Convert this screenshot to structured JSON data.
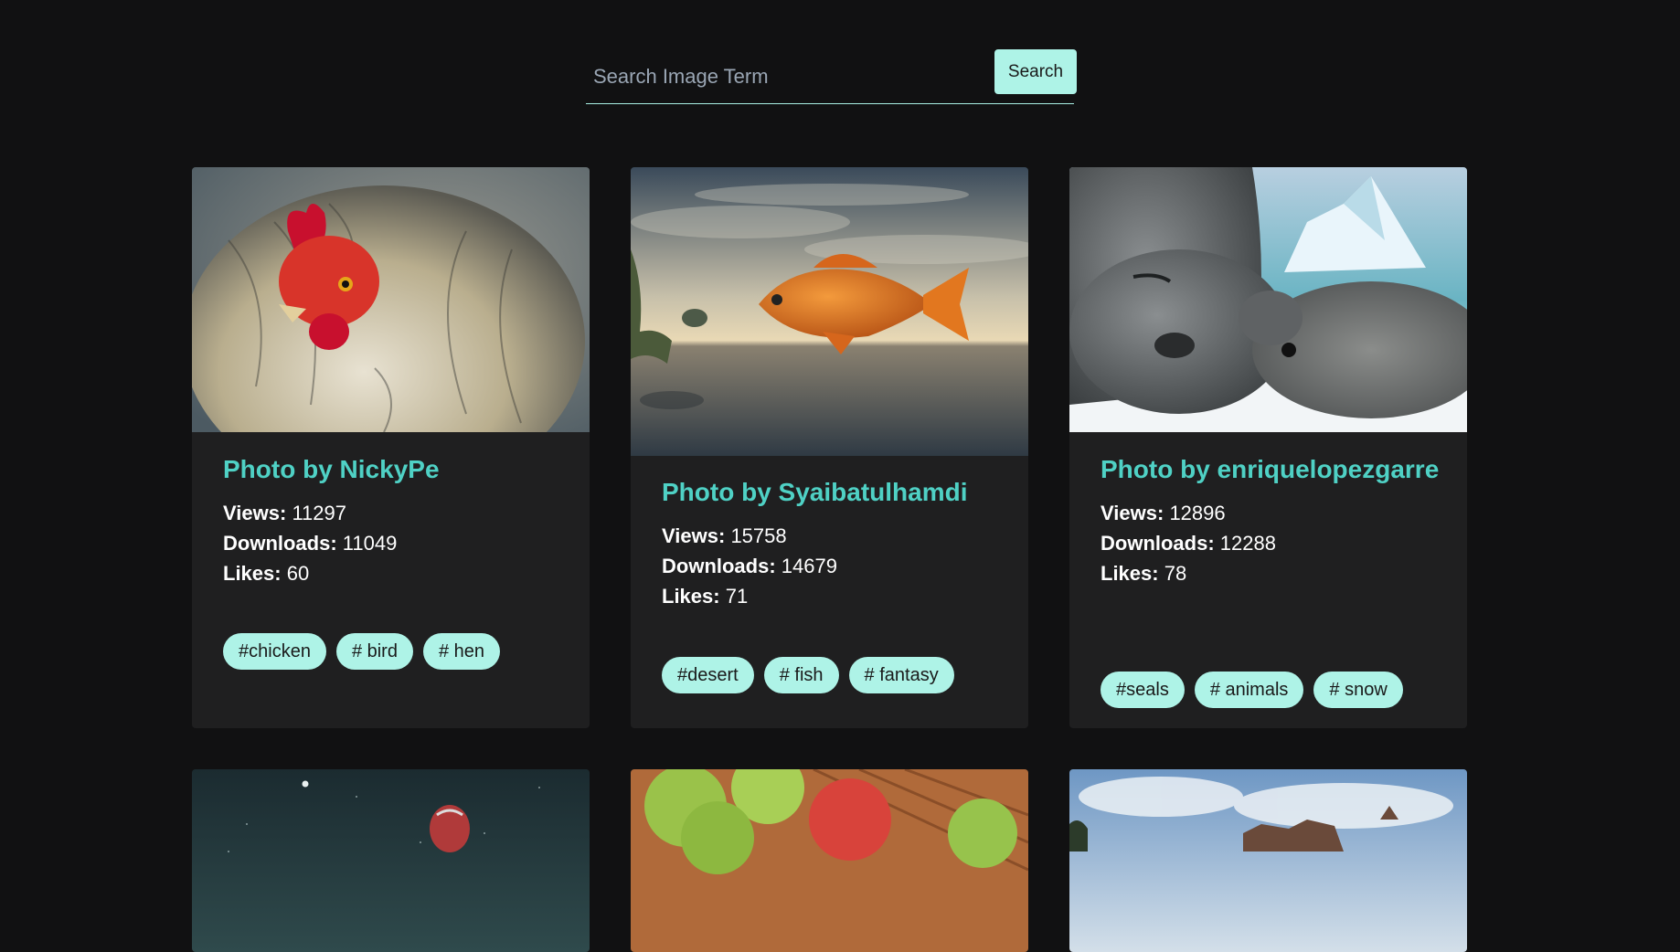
{
  "search": {
    "placeholder": "Search Image Term",
    "button_label": "Search",
    "accent_color": "#aef3e7"
  },
  "labels": {
    "views": "Views:",
    "downloads": "Downloads:",
    "likes": "Likes:"
  },
  "cards": [
    {
      "title": "Photo by NickyPe",
      "views": "11297",
      "downloads": "11049",
      "likes": "60",
      "tags": [
        "#chicken",
        "# bird",
        "# hen"
      ],
      "image": "chicken photo"
    },
    {
      "title": "Photo by Syaibatulhamdi",
      "views": "15758",
      "downloads": "14679",
      "likes": "71",
      "tags": [
        "#desert",
        "# fish",
        "# fantasy"
      ],
      "image": "orange fish over desert photo"
    },
    {
      "title": "Photo by enriquelopezgarre",
      "views": "12896",
      "downloads": "12288",
      "likes": "78",
      "tags": [
        "#seals",
        "# animals",
        "# snow"
      ],
      "image": "seals in snow photo"
    },
    {
      "image": "hot air balloon night sky photo"
    },
    {
      "image": "apples on wooden table photo"
    },
    {
      "image": "building under cloudy sky photo"
    }
  ],
  "colors": {
    "background": "#111112",
    "card_background": "#1f1f20",
    "title_color": "#4fd1c5",
    "tag_background": "#aef3e7"
  }
}
